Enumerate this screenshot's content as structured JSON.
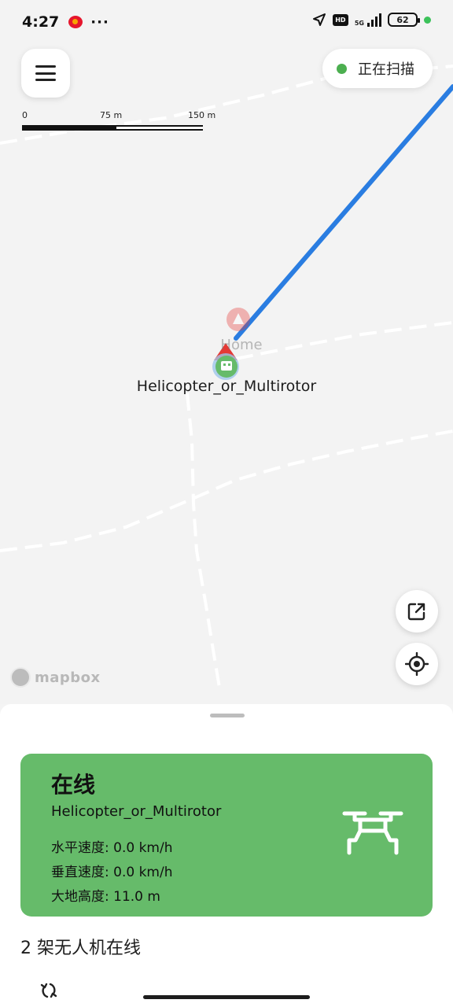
{
  "status_bar": {
    "time": "4:27",
    "dots": "···",
    "hd_label": "HD",
    "network_label": "5G",
    "battery": "62"
  },
  "map": {
    "scan_status": "正在扫描",
    "scale_labels": [
      "0",
      "75 m",
      "150 m"
    ],
    "drone_label": "Helicopter_or_Multirotor",
    "home_label": "Home",
    "attribution": "mapbox"
  },
  "card": {
    "status": "在线",
    "name": "Helicopter_or_Multirotor",
    "horizontal_speed": "水平速度: 0.0 km/h",
    "vertical_speed": "垂直速度: 0.0 km/h",
    "altitude": "大地高度: 11.0 m",
    "color": "#66bb6a"
  },
  "online_count": "2 架无人机在线",
  "colors": {
    "accent_green": "#4caf50",
    "track_blue": "#2a7de1",
    "home_marker": "#e53935"
  }
}
